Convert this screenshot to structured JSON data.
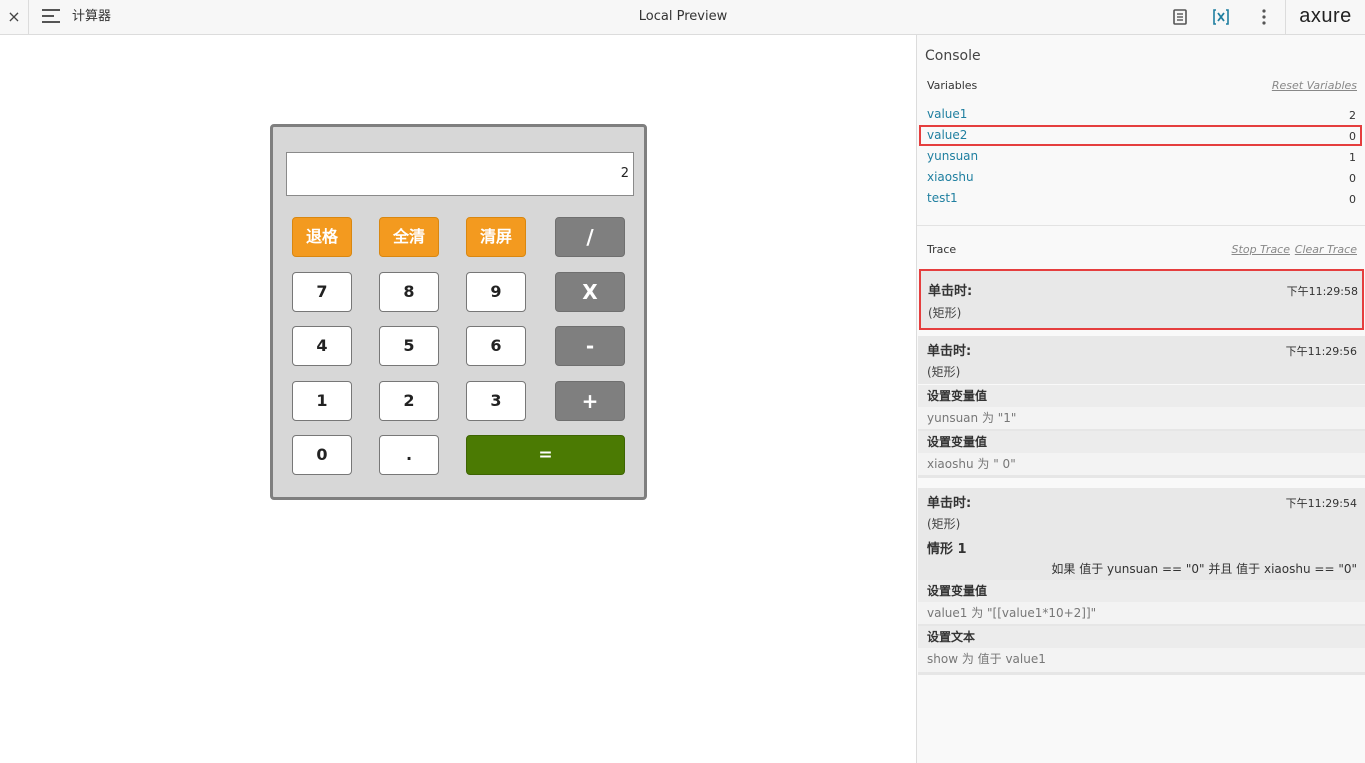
{
  "topbar": {
    "close": "×",
    "page_name": "计算器",
    "title": "Local Preview",
    "brand": "axure",
    "icons": [
      "close-icon",
      "menu-icon",
      "notes-icon",
      "variables-icon",
      "more-icon"
    ]
  },
  "calculator": {
    "display_value": "2",
    "keys": {
      "backspace": "退格",
      "clear_all": "全清",
      "clear_screen": "清屏",
      "divide": "/",
      "seven": "7",
      "eight": "8",
      "nine": "9",
      "multiply": "X",
      "four": "4",
      "five": "5",
      "six": "6",
      "minus": "-",
      "one": "1",
      "two": "2",
      "three": "3",
      "plus": "+",
      "zero": "0",
      "dot": ".",
      "equals": "="
    },
    "colors": {
      "orange": "#f39a1f",
      "gray": "#7f7f7f",
      "green": "#4b7a03",
      "body": "#d7d7d7"
    }
  },
  "console": {
    "title": "Console",
    "variables_label": "Variables",
    "reset_variables": "Reset Variables",
    "variables": [
      {
        "name": "value1",
        "value": "2"
      },
      {
        "name": "value2",
        "value": "0"
      },
      {
        "name": "yunsuan",
        "value": "1"
      },
      {
        "name": "xiaoshu",
        "value": "0"
      },
      {
        "name": "test1",
        "value": "0"
      }
    ],
    "trace_label": "Trace",
    "stop_trace": "Stop Trace",
    "clear_trace": "Clear Trace",
    "traces": [
      {
        "event": "单击时:",
        "time": "下午11:29:58",
        "target": "(矩形)"
      },
      {
        "event": "单击时:",
        "time": "下午11:29:56",
        "target": "(矩形)",
        "actions": [
          {
            "title": "设置变量值",
            "detail": "yunsuan 为 \"1\""
          },
          {
            "title": "设置变量值",
            "detail": "xiaoshu 为 \" 0\""
          }
        ]
      },
      {
        "event": "单击时:",
        "time": "下午11:29:54",
        "target": "(矩形)",
        "case": "情形 1",
        "condition": "如果 值于 yunsuan == \"0\" 并且 值于 xiaoshu == \"0\"",
        "actions": [
          {
            "title": "设置变量值",
            "detail": "value1 为 \"[[value1*10+2]]\""
          },
          {
            "title": "设置文本",
            "detail": "show 为 值于 value1"
          }
        ]
      }
    ],
    "highlight_color": "#e53e3e",
    "variable_color": "#1f7fa0"
  }
}
